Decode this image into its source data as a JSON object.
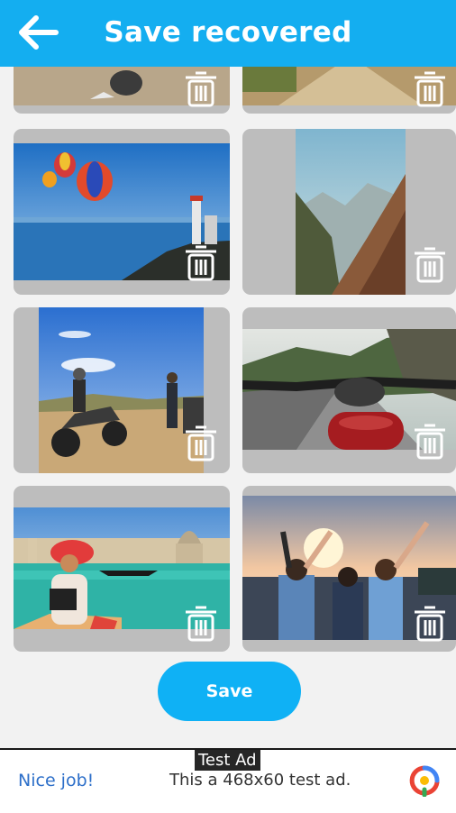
{
  "header": {
    "title": "Save recovered"
  },
  "gallery": {
    "items": [
      {
        "name": "recovered-image-beach-partial"
      },
      {
        "name": "recovered-image-path-partial"
      },
      {
        "name": "recovered-image-balloons-lighthouse"
      },
      {
        "name": "recovered-image-mountain-valley"
      },
      {
        "name": "recovered-image-motorbike-riders"
      },
      {
        "name": "recovered-image-motorbike-road"
      },
      {
        "name": "recovered-image-venice-girl"
      },
      {
        "name": "recovered-image-friends-sunset"
      }
    ]
  },
  "actions": {
    "save_label": "Save"
  },
  "ad": {
    "badge": "Test Ad",
    "left_text": "Nice job!",
    "body_text": "This a 468x60 test ad."
  },
  "colors": {
    "accent": "#14aef0",
    "save_button": "#0fb1f5",
    "card_background": "#bdbdbd"
  }
}
